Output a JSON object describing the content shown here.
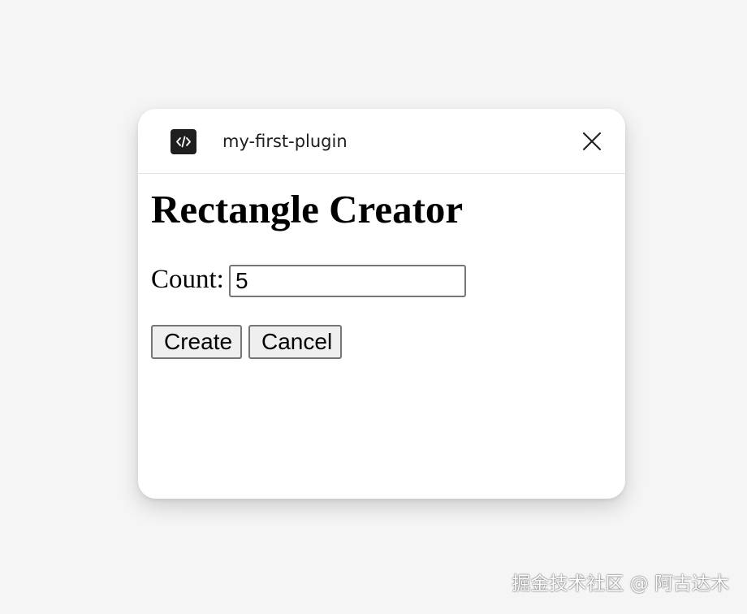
{
  "titlebar": {
    "icon": "code-brackets-icon",
    "plugin_name": "my-first-plugin",
    "close_icon": "close-icon"
  },
  "plugin": {
    "heading": "Rectangle Creator",
    "count_label": "Count:",
    "count_value": "5",
    "create_label": "Create",
    "cancel_label": "Cancel"
  },
  "watermark": "掘金技术社区 @ 阿古达木",
  "colors": {
    "page_background": "#f5f5f5",
    "dialog_background": "#ffffff",
    "icon_background": "#1e1e1e",
    "button_background": "#efefef"
  }
}
